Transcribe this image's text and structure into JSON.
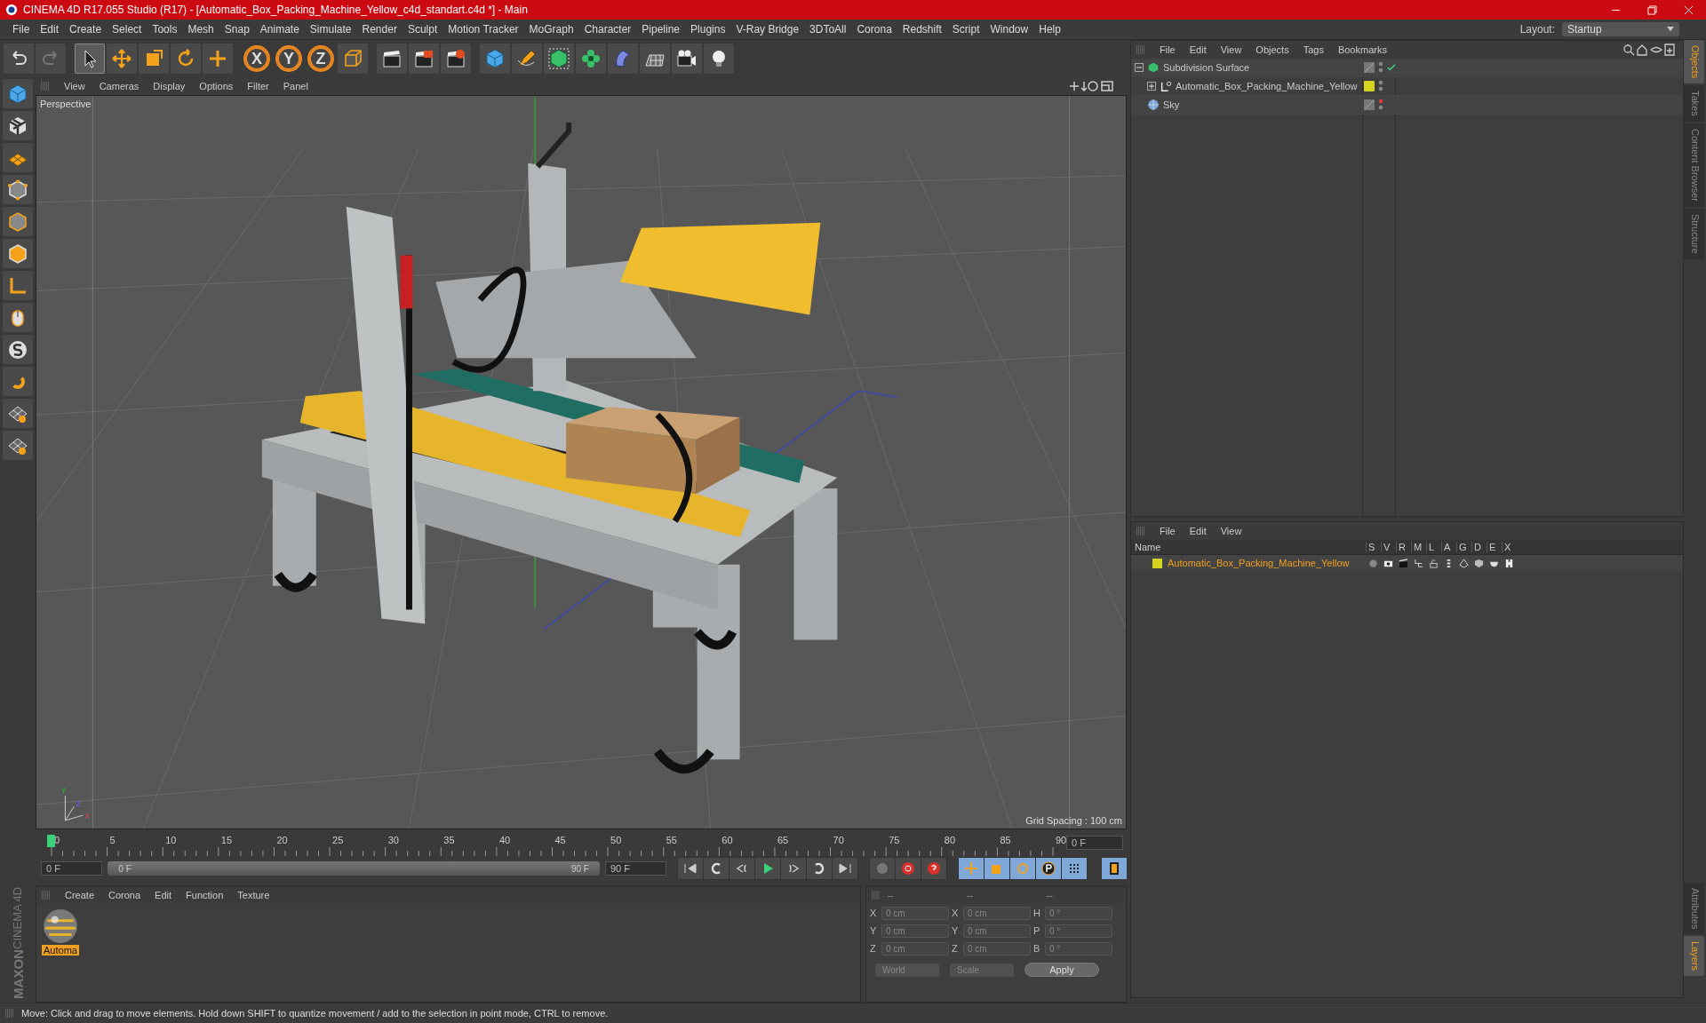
{
  "window": {
    "title": "CINEMA 4D R17.055 Studio (R17) - [Automatic_Box_Packing_Machine_Yellow_c4d_standart.c4d *] - Main"
  },
  "menu": [
    "File",
    "Edit",
    "Create",
    "Select",
    "Tools",
    "Mesh",
    "Snap",
    "Animate",
    "Simulate",
    "Render",
    "Sculpt",
    "Motion Tracker",
    "MoGraph",
    "Character",
    "Pipeline",
    "Plugins",
    "V-Ray Bridge",
    "3DToAll",
    "Corona",
    "Redshift",
    "Script",
    "Window",
    "Help"
  ],
  "layout": {
    "label": "Layout:",
    "value": "Startup"
  },
  "axis_locks": [
    {
      "label": "X",
      "on": true
    },
    {
      "label": "Y",
      "on": true
    },
    {
      "label": "Z",
      "on": true
    }
  ],
  "viewport": {
    "menu": [
      "View",
      "Cameras",
      "Display",
      "Options",
      "Filter",
      "Panel"
    ],
    "camera": "Perspective",
    "grid_spacing": "Grid Spacing : 100 cm",
    "axis_labels": [
      "Y",
      "Z",
      "X"
    ]
  },
  "timeline": {
    "ticks": [
      "0",
      "5",
      "10",
      "15",
      "20",
      "25",
      "30",
      "35",
      "40",
      "45",
      "50",
      "55",
      "60",
      "65",
      "70",
      "75",
      "80",
      "85",
      "90"
    ],
    "playhead": {
      "level": 0
    },
    "current_frame": "0 F",
    "start": "0 F",
    "range": {
      "start": "0 F",
      "end": "90 F",
      "level": 1
    },
    "end": "90 F"
  },
  "materials": {
    "menu": [
      "Create",
      "Corona",
      "Edit",
      "Function",
      "Texture"
    ],
    "items": [
      {
        "label": "Automa",
        "selected": true
      }
    ]
  },
  "coordinates": {
    "headers": [
      "--",
      "--",
      "--"
    ],
    "rows": [
      {
        "axis": "X",
        "position": "0 cm",
        "size_axis": "X",
        "size": "0 cm",
        "rot_axis": "H",
        "rotation": "0 °"
      },
      {
        "axis": "Y",
        "position": "0 cm",
        "size_axis": "Y",
        "size": "0 cm",
        "rot_axis": "P",
        "rotation": "0 °"
      },
      {
        "axis": "Z",
        "position": "0 cm",
        "size_axis": "Z",
        "size": "0 cm",
        "rot_axis": "B",
        "rotation": "0 °"
      }
    ],
    "mode": "World",
    "transform": "Scale",
    "apply": "Apply"
  },
  "objects": {
    "menu": [
      "File",
      "Edit",
      "View",
      "Objects",
      "Tags",
      "Bookmarks"
    ],
    "items": [
      {
        "name": "Subdivision Surface",
        "kind": "subdivision",
        "expanded": true,
        "enabled": true,
        "render_visible": true,
        "children": [
          {
            "name": "Automatic_Box_Packing_Machine_Yellow",
            "kind": "null",
            "expanded": false,
            "color": "#d4d21c",
            "render_visible": true
          }
        ]
      },
      {
        "name": "Sky",
        "kind": "sky",
        "render_visible": false
      }
    ]
  },
  "layers": {
    "menu": [
      "File",
      "Edit",
      "View"
    ],
    "columns": [
      "Name",
      "S",
      "V",
      "R",
      "M",
      "L",
      "A",
      "G",
      "D",
      "E",
      "X"
    ],
    "items": [
      {
        "name": "Automatic_Box_Packing_Machine_Yellow",
        "color": "#d4d21c",
        "selected": true
      }
    ]
  },
  "side_tabs": {
    "top": [
      {
        "label": "Objects",
        "selected": true
      },
      {
        "label": "Takes",
        "selected": false
      },
      {
        "label": "Content Browser",
        "selected": false
      },
      {
        "label": "Structure",
        "selected": false
      }
    ],
    "bottom": [
      {
        "label": "Attributes",
        "selected": false
      },
      {
        "label": "Layers",
        "selected": true
      }
    ]
  },
  "logo": {
    "brand": "MAXON",
    "product": "CINEMA 4D"
  },
  "status_bar": "Move: Click and drag to move elements. Hold down SHIFT to quantize movement / add to the selection in point mode, CTRL to remove."
}
